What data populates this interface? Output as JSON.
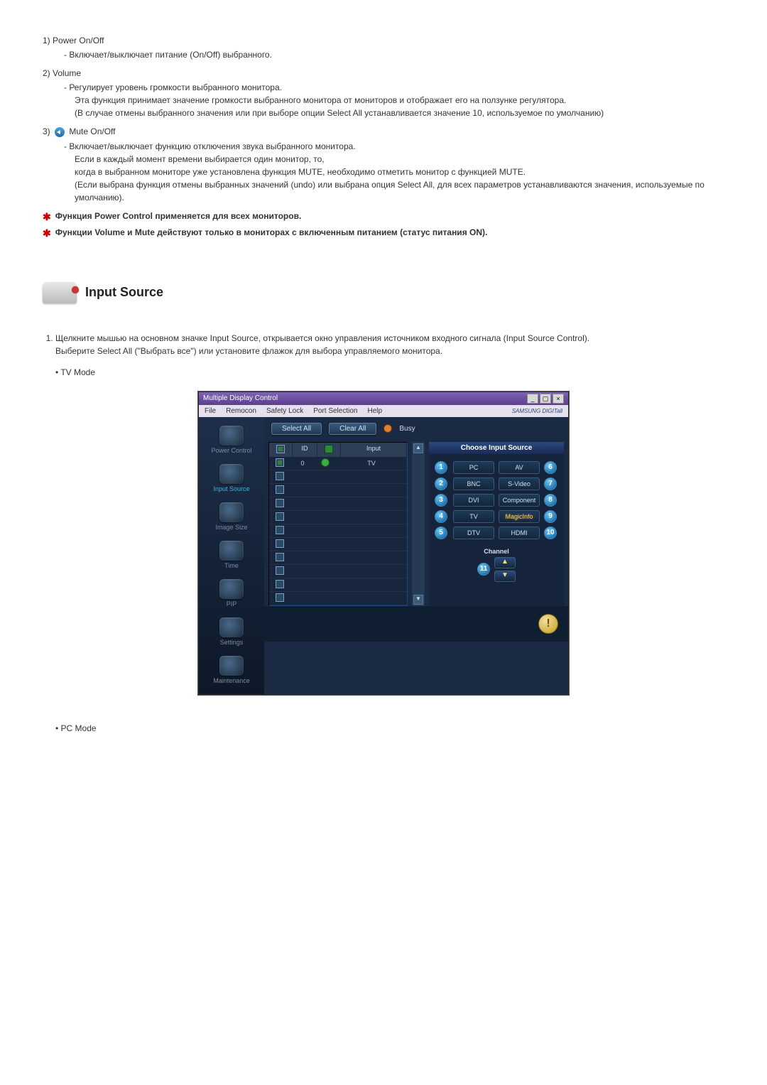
{
  "items": [
    {
      "num": "1)",
      "title": "Power On/Off",
      "lines": [
        "- Включает/выключает питание (On/Off) выбранного."
      ]
    },
    {
      "num": "2)",
      "title": "Volume",
      "lines": [
        "- Регулирует уровень громкости выбранного монитора.",
        "Эта функция принимает значение громкости выбранного монитора от мониторов и отображает его на ползунке регулятора.",
        "(В случае отмены выбранного значения или при выборе опции Select All устанавливается значение 10, используемое по умолчанию)"
      ]
    },
    {
      "num": "3)",
      "title": "Mute On/Off",
      "icon": true,
      "lines": [
        "- Включает/выключает функцию отключения звука выбранного монитора.",
        "Если в каждый момент времени выбирается один монитор, то,",
        "когда в выбранном мониторе уже установлена функция MUTE, необходимо отметить монитор с функцией MUTE.",
        "(Если выбрана функция отмены выбранных значений (undo) или выбрана опция Select All, для всех параметров устанавливаются значения, используемые по умолчанию)."
      ]
    }
  ],
  "notes": [
    "Функция Power Control применяется для всех мониторов.",
    "Функции Volume и Mute действуют только в мониторах с включенным питанием (статус питания ON)."
  ],
  "section_title": "Input Source",
  "instruction": {
    "p1": "Щелкните мышью на основном значке Input Source, открывается окно управления источником входного сигнала (Input Source Control).",
    "p2": "Выберите Select All (\"Выбрать все\") или установите флажок для выбора управляемого монитора."
  },
  "bullets": {
    "tv": "TV Mode",
    "pc": "PC Mode"
  },
  "app": {
    "title": "Multiple Display Control",
    "menu": [
      "File",
      "Remocon",
      "Safety Lock",
      "Port Selection",
      "Help"
    ],
    "brand": "SAMSUNG DIGITall",
    "toolbar": {
      "select_all": "Select All",
      "clear_all": "Clear All",
      "busy": "Busy"
    },
    "sidebar": [
      {
        "label": "Power Control"
      },
      {
        "label": "Input Source",
        "active": true
      },
      {
        "label": "Image Size"
      },
      {
        "label": "Time"
      },
      {
        "label": "PIP"
      },
      {
        "label": "Settings"
      },
      {
        "label": "Maintenance"
      }
    ],
    "grid": {
      "headers": {
        "chk": "",
        "id": "ID",
        "status": "",
        "input": "Input"
      },
      "first_row": {
        "id": "0",
        "input": "TV"
      },
      "blank_rows": 10
    },
    "panel": {
      "title": "Choose Input Source",
      "sources_left": [
        {
          "n": "1",
          "l": "PC"
        },
        {
          "n": "2",
          "l": "BNC"
        },
        {
          "n": "3",
          "l": "DVI"
        },
        {
          "n": "4",
          "l": "TV"
        },
        {
          "n": "5",
          "l": "DTV"
        }
      ],
      "sources_right": [
        {
          "n": "6",
          "l": "AV"
        },
        {
          "n": "7",
          "l": "S-Video"
        },
        {
          "n": "8",
          "l": "Component"
        },
        {
          "n": "9",
          "l": "MagicInfo",
          "glow": true
        },
        {
          "n": "10",
          "l": "HDMI"
        }
      ],
      "channel": {
        "label": "Channel",
        "badge": "11"
      }
    }
  }
}
